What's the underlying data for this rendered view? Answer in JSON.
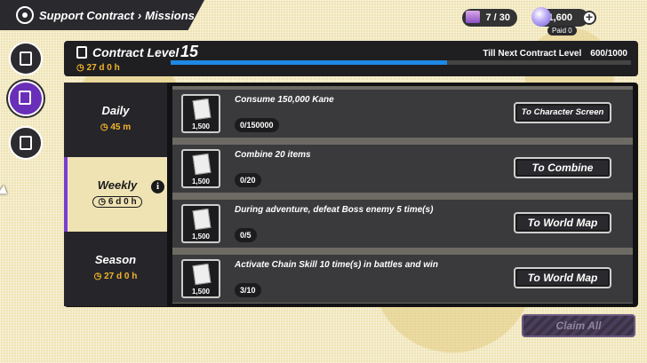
{
  "header": {
    "section": "Support Contract",
    "page": "Missions"
  },
  "resources": {
    "contract_tickets": "7 / 30",
    "gems": "1,600",
    "paid_label": "Paid",
    "paid_value": "0"
  },
  "contract": {
    "label": "Contract Level",
    "level": "15",
    "time": "27 d 0 h",
    "next_label": "Till Next Contract Level",
    "next_value": "600/1000",
    "progress": 0.6
  },
  "tabs": [
    {
      "name": "Daily",
      "time": "45 m"
    },
    {
      "name": "Weekly",
      "time": "6 d 0 h"
    },
    {
      "name": "Season",
      "time": "27 d 0 h"
    }
  ],
  "missions": [
    {
      "reward": "1,500",
      "text": "Consume 150,000 Kane",
      "progress": "0/150000",
      "action": "To Character Screen"
    },
    {
      "reward": "1,500",
      "text": "Combine 20 items",
      "progress": "0/20",
      "action": "To Combine"
    },
    {
      "reward": "1,500",
      "text": "During adventure, defeat Boss enemy 5 time(s)",
      "progress": "0/5",
      "action": "To World Map"
    },
    {
      "reward": "1,500",
      "text": "Activate Chain Skill 10 time(s) in battles and win",
      "progress": "3/10",
      "action": "To World Map"
    }
  ],
  "claim_all": "Claim All",
  "icons": [
    "logo-icon",
    "contract-ticket-icon",
    "gem-icon",
    "plus-icon",
    "mission-list-icon",
    "contract-edit-icon",
    "shop-search-icon",
    "document-icon",
    "clock-icon",
    "info-icon"
  ]
}
